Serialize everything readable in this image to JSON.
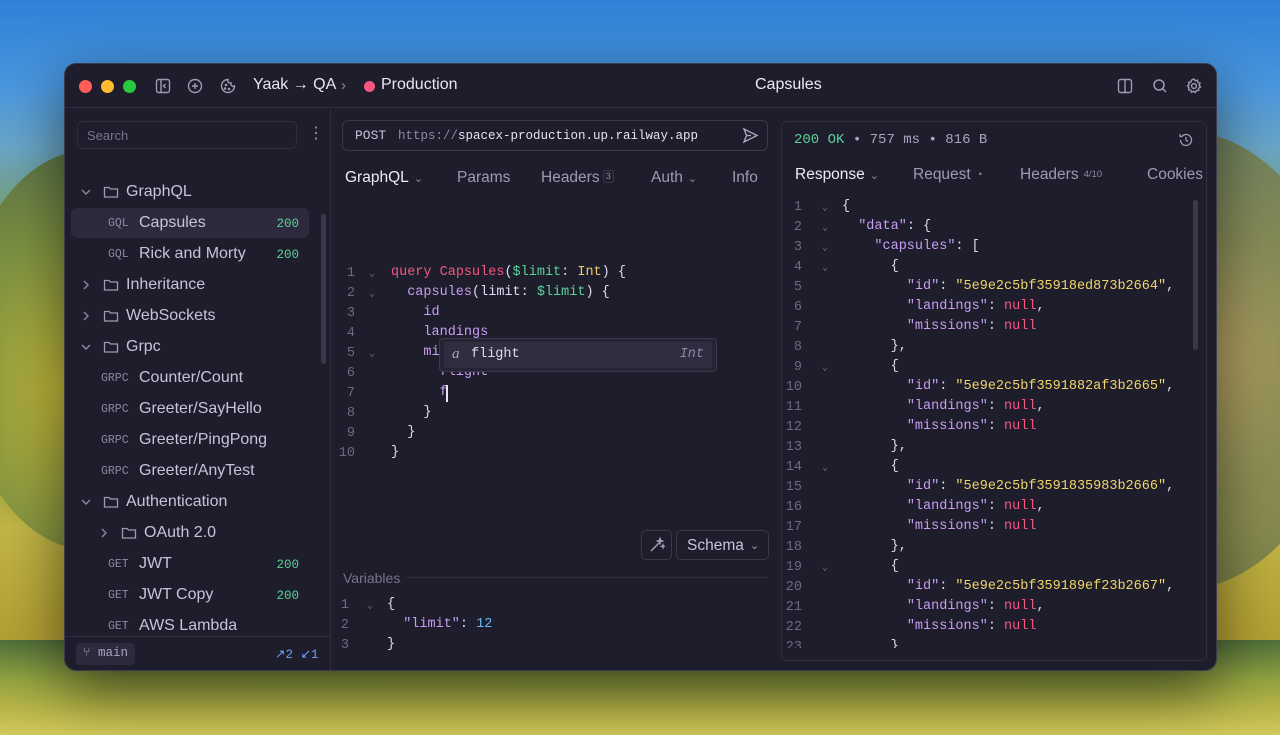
{
  "titlebar": {
    "workspace": "Yaak → QA",
    "environment": "Production",
    "title": "Capsules"
  },
  "sidebar": {
    "search_placeholder": "Search",
    "items": [
      {
        "type": "folder",
        "label": "GraphQL",
        "expanded": true
      },
      {
        "type": "request",
        "method": "GQL",
        "label": "Capsules",
        "status": "200",
        "active": true
      },
      {
        "type": "request",
        "method": "GQL",
        "label": "Rick and Morty",
        "status": "200"
      },
      {
        "type": "folder",
        "label": "Inheritance",
        "expanded": false
      },
      {
        "type": "folder",
        "label": "WebSockets",
        "expanded": false
      },
      {
        "type": "folder",
        "label": "Grpc",
        "expanded": true
      },
      {
        "type": "request",
        "method": "GRPC",
        "label": "Counter/Count"
      },
      {
        "type": "request",
        "method": "GRPC",
        "label": "Greeter/SayHello"
      },
      {
        "type": "request",
        "method": "GRPC",
        "label": "Greeter/PingPong"
      },
      {
        "type": "request",
        "method": "GRPC",
        "label": "Greeter/AnyTest"
      },
      {
        "type": "folder",
        "label": "Authentication",
        "expanded": true
      },
      {
        "type": "folder",
        "label": "OAuth 2.0",
        "expanded": false
      },
      {
        "type": "request",
        "method": "GET",
        "label": "JWT",
        "status": "200"
      },
      {
        "type": "request",
        "method": "GET",
        "label": "JWT Copy",
        "status": "200"
      },
      {
        "type": "request",
        "method": "GET",
        "label": "AWS Lambda"
      }
    ],
    "footer": {
      "branch": "main",
      "ahead": "↗2",
      "behind": "↙1"
    }
  },
  "request": {
    "method": "POST",
    "url_scheme": "https://",
    "url_host": "spacex-production.up.railway.app",
    "tabs": {
      "graphql": "GraphQL",
      "params": "Params",
      "headers": "Headers",
      "headers_count": "3",
      "auth": "Auth",
      "info": "Info"
    },
    "autocomplete": {
      "kind": "a",
      "name": "flight",
      "type": "Int"
    },
    "schema_label": "Schema",
    "variables_label": "Variables"
  },
  "response": {
    "status": "200 OK",
    "time": "757 ms",
    "size": "816 B",
    "tabs": {
      "response": "Response",
      "request": "Request",
      "headers": "Headers",
      "headers_count": "4/10",
      "cookies": "Cookies"
    },
    "ids": [
      "5e9e2c5bf35918ed873b2664",
      "5e9e2c5bf3591882af3b2665",
      "5e9e2c5bf3591835983b2666",
      "5e9e2c5bf359189ef23b2667"
    ]
  },
  "colors": {
    "accent_env": "#f4577f",
    "status_ok": "#5ad19a",
    "keyword": "#f4577f",
    "string": "#f1d56b",
    "field": "#c89df3"
  }
}
